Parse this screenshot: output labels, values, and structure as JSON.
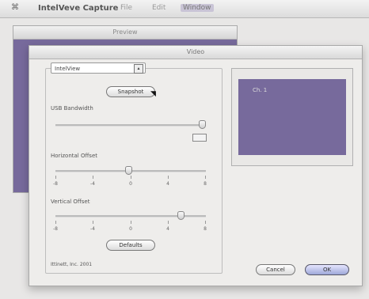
{
  "menubar": {
    "apple": "⌘",
    "app_name": "IntelVeve Capture",
    "items": [
      "File",
      "Edit",
      "Window"
    ]
  },
  "preview_window": {
    "title": "Preview"
  },
  "dialog": {
    "title": "Video",
    "source_select": "IntelView",
    "snapshot_label": "Snapshot",
    "usb_bandwidth_label": "USB Bandwidth",
    "horizontal_offset_label": "Horizontal Offset",
    "horizontal_ticks": [
      "-8",
      "-4",
      "0",
      "4",
      "8"
    ],
    "vertical_offset_label": "Vertical Offset",
    "vertical_ticks": [
      "-8",
      "-4",
      "0",
      "4",
      "8"
    ],
    "defaults_label": "Defaults",
    "copyright": "Ittinett, Inc. 2001",
    "cancel_label": "Cancel",
    "ok_label": "OK",
    "preview_label": "Ch. 1",
    "usb_bandwidth_level": 1.0,
    "horizontal_offset_value": 0,
    "vertical_offset_value": 4
  },
  "colors": {
    "preview_purple": "#776a9c"
  }
}
